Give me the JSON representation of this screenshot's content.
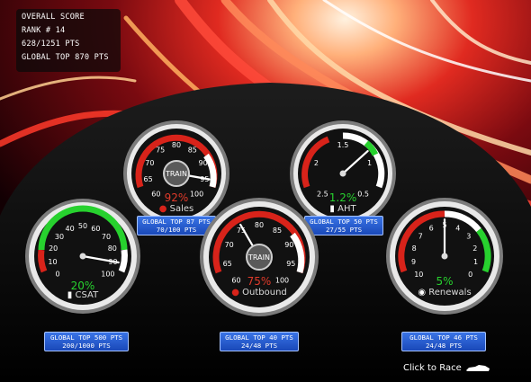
{
  "score": {
    "title": "OVERALL SCORE",
    "rank": "RANK # 14",
    "points": "628/1251 PTS",
    "global": "GLOBAL TOP 870 PTS"
  },
  "gauges": {
    "sales": {
      "label": "Sales",
      "percent": "92%",
      "pct_color": "#e03a2a",
      "ticks": [
        "60",
        "65",
        "70",
        "75",
        "80",
        "85",
        "90",
        "95",
        "100"
      ],
      "hub_text": "TRAIN",
      "plaque_top": "GLOBAL TOP 87 PTS",
      "plaque_bot": "70/100 PTS"
    },
    "aht": {
      "label": "AHT",
      "percent": "1.2%",
      "pct_color": "#27d12e",
      "ticks": [
        "2.5",
        "2",
        "1.5",
        "1",
        "0.5"
      ],
      "plaque_top": "GLOBAL TOP 50 PTS",
      "plaque_bot": "27/55 PTS"
    },
    "csat": {
      "label": "CSAT",
      "percent": "20%",
      "pct_color": "#27d12e",
      "ticks": [
        "0",
        "10",
        "20",
        "30",
        "40",
        "50",
        "60",
        "70",
        "80",
        "90",
        "100"
      ],
      "plaque_top": "GLOBAL TOP 500 PTS",
      "plaque_bot": "200/1000 PTS"
    },
    "outbound": {
      "label": "Outbound",
      "percent": "75%",
      "pct_color": "#e03a2a",
      "ticks": [
        "60",
        "65",
        "70",
        "75",
        "80",
        "85",
        "90",
        "95",
        "100"
      ],
      "hub_text": "TRAIN",
      "plaque_top": "GLOBAL TOP 40 PTS",
      "plaque_bot": "24/48 PTS"
    },
    "renewals": {
      "label": "Renewals",
      "percent": "5%",
      "pct_color": "#27d12e",
      "ticks": [
        "10",
        "9",
        "8",
        "7",
        "6",
        "5",
        "4",
        "3",
        "2",
        "1",
        "0"
      ],
      "plaque_top": "GLOBAL TOP 46 PTS",
      "plaque_bot": "24/48 PTS"
    }
  },
  "race": {
    "label": "Click to Race"
  },
  "icons": {
    "sales": "car-icon",
    "aht": "battery-icon",
    "csat": "fuel-icon",
    "outbound": "car-icon",
    "renewals": "tire-icon",
    "race": "race-car-icon"
  }
}
